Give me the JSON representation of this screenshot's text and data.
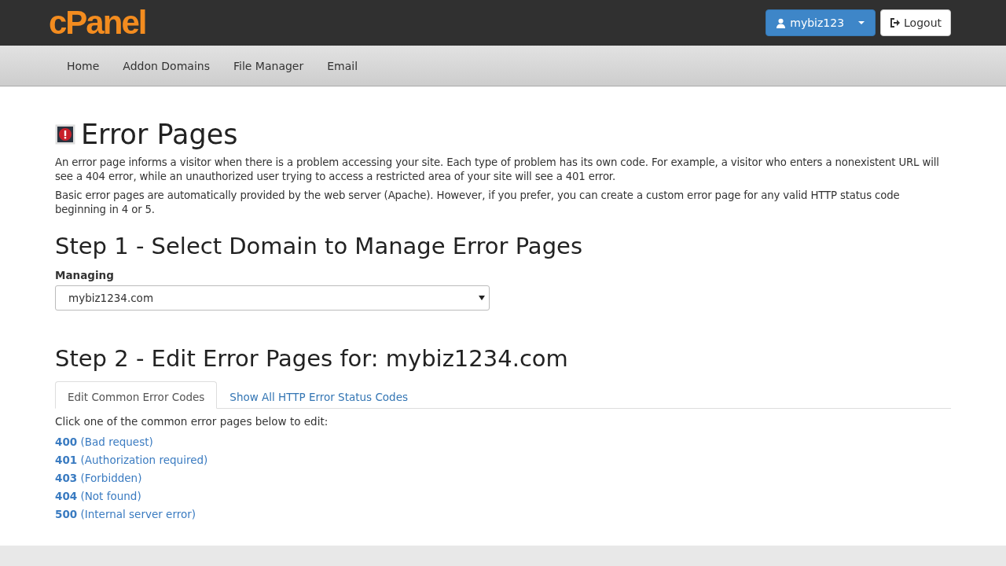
{
  "header": {
    "logo": "cPanel",
    "user_button": "mybiz123",
    "logout_button": "Logout"
  },
  "nav": [
    {
      "label": "Home"
    },
    {
      "label": "Addon Domains"
    },
    {
      "label": "File Manager"
    },
    {
      "label": "Email"
    }
  ],
  "title": "Error Pages",
  "intro": [
    "An error page informs a visitor when there is a problem accessing your site. Each type of problem has its own code. For example, a visitor who enters a nonexistent URL will see a 404 error, while an unauthorized user trying to access a restricted area of your site will see a 401 error.",
    "Basic error pages are automatically provided by the web server (Apache). However, if you prefer, you can create a custom error page for any valid HTTP status code beginning in 4 or 5."
  ],
  "step1": {
    "heading": "Step 1 - Select Domain to Manage Error Pages",
    "label": "Managing",
    "value": "mybiz1234.com"
  },
  "step2": {
    "heading": "Step 2 - Edit Error Pages for: mybiz1234.com",
    "tabs": [
      {
        "label": "Edit Common Error Codes",
        "selected": true
      },
      {
        "label": "Show All HTTP Error Status Codes",
        "selected": false
      }
    ],
    "instruction": "Click one of the common error pages below to edit:",
    "links": [
      {
        "code": "400",
        "description": "(Bad request)"
      },
      {
        "code": "401",
        "description": "(Authorization required)"
      },
      {
        "code": "403",
        "description": "(Forbidden)"
      },
      {
        "code": "404",
        "description": "(Not found)"
      },
      {
        "code": "500",
        "description": "(Internal server error)"
      }
    ]
  }
}
